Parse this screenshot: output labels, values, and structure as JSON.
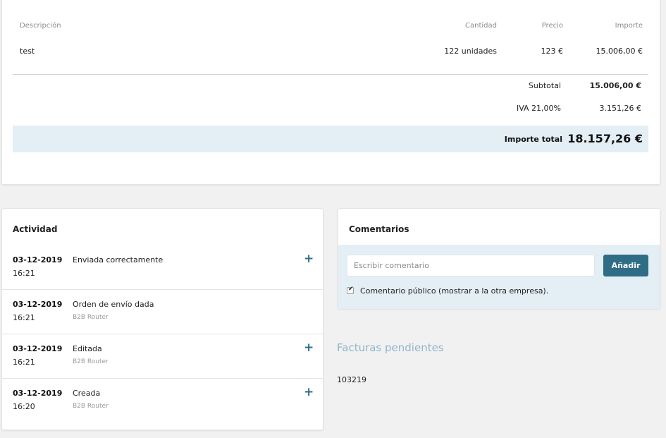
{
  "invoice": {
    "headers": {
      "description": "Descripción",
      "quantity": "Cantidad",
      "price": "Precio",
      "amount": "Importe"
    },
    "rows": [
      {
        "description": "test",
        "quantity": "122 unidades",
        "price": "123 €",
        "amount": "15.006,00 €"
      }
    ],
    "subtotal_label": "Subtotal",
    "subtotal_value": "15.006,00 €",
    "tax_label": "IVA 21,00%",
    "tax_value": "3.151,26 €",
    "total_label": "Importe total",
    "total_value": "18.157,26 €"
  },
  "activity": {
    "title": "Actividad",
    "items": [
      {
        "date": "03-12-2019",
        "time": "16:21",
        "title": "Enviada correctamente",
        "sub": "",
        "expandable": true
      },
      {
        "date": "03-12-2019",
        "time": "16:21",
        "title": "Orden de envío dada",
        "sub": "B2B Router",
        "expandable": false
      },
      {
        "date": "03-12-2019",
        "time": "16:21",
        "title": "Editada",
        "sub": "B2B Router",
        "expandable": true
      },
      {
        "date": "03-12-2019",
        "time": "16:20",
        "title": "Creada",
        "sub": "B2B Router",
        "expandable": true
      }
    ],
    "expand_glyph": "+"
  },
  "comments": {
    "title": "Comentarios",
    "input_placeholder": "Escribir comentario",
    "input_value": "",
    "add_label": "Añadir",
    "public_checked": true,
    "public_label": "Comentario público (mostrar a la otra empresa)."
  },
  "pending": {
    "title": "Facturas pendientes",
    "items": [
      "103219"
    ]
  },
  "colors": {
    "accent": "#2f6d86",
    "highlight_bg": "#e3eef5",
    "pending_title": "#8fb6cc"
  }
}
